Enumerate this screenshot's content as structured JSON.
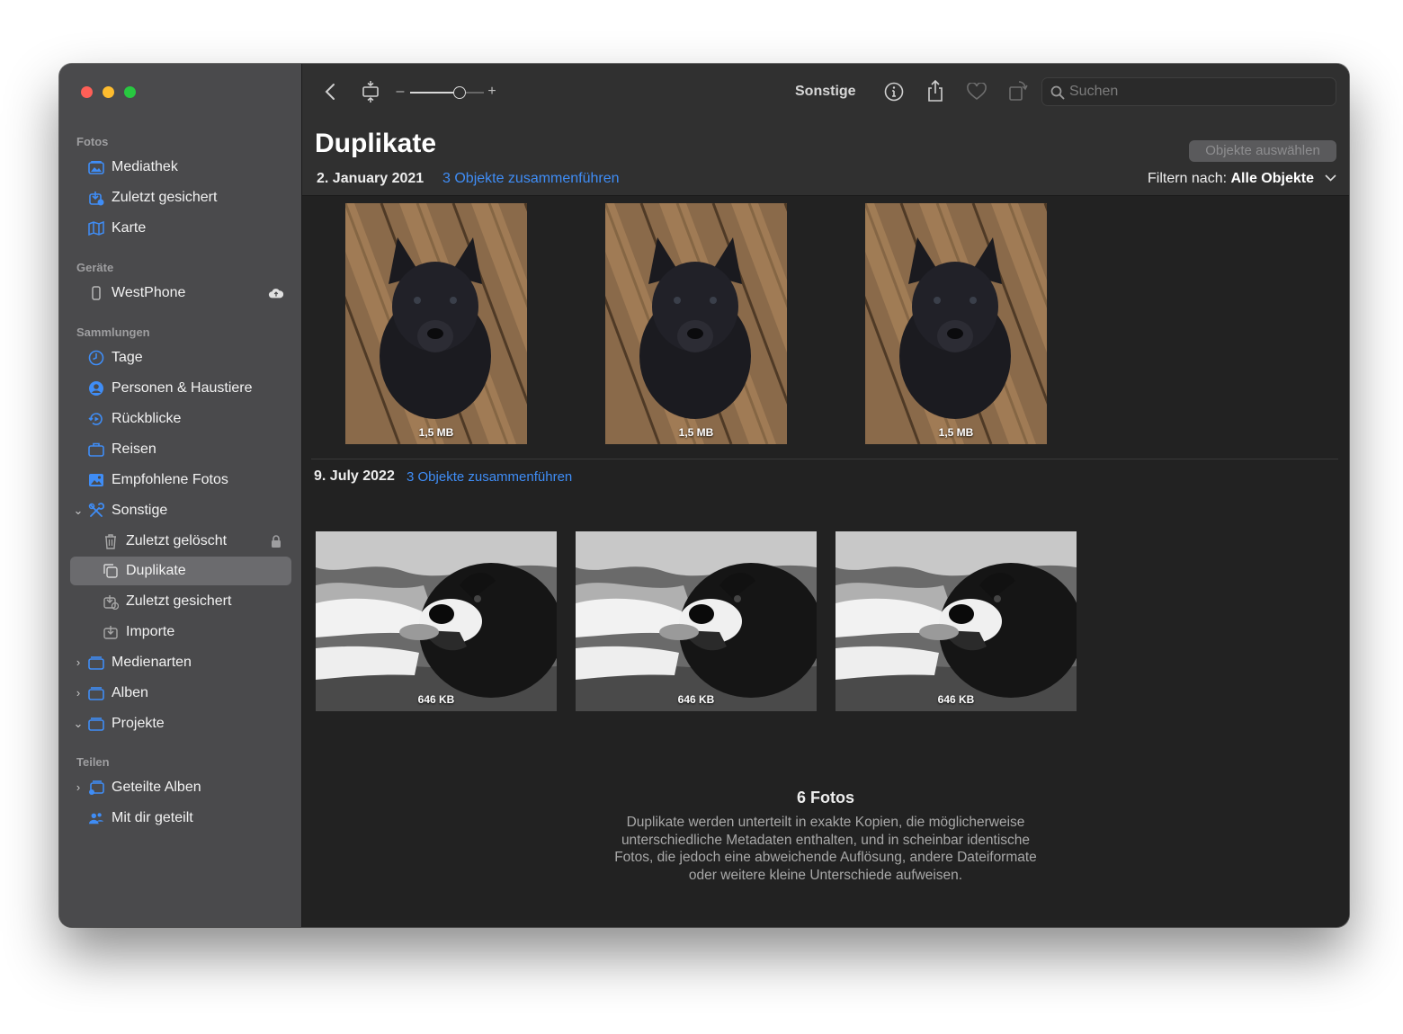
{
  "sidebar": {
    "sections": {
      "fotos": "Fotos",
      "geraete": "Geräte",
      "sammlungen": "Sammlungen",
      "teilen": "Teilen"
    },
    "items": {
      "mediathek": "Mediathek",
      "zuletzt_gesichert": "Zuletzt gesichert",
      "karte": "Karte",
      "westphone": "WestPhone",
      "tage": "Tage",
      "personen": "Personen & Haustiere",
      "rueckblicke": "Rückblicke",
      "reisen": "Reisen",
      "empfohlene": "Empfohlene Fotos",
      "sonstige": "Sonstige",
      "zuletzt_geloescht": "Zuletzt gelöscht",
      "duplikate": "Duplikate",
      "zuletzt_gesichert_sub": "Zuletzt gesichert",
      "importe": "Importe",
      "medienarten": "Medienarten",
      "alben": "Alben",
      "projekte": "Projekte",
      "geteilte_alben": "Geteilte Alben",
      "mit_dir_geteilt": "Mit dir geteilt"
    },
    "selected": "Duplikate"
  },
  "toolbar": {
    "zoom_minus": "–",
    "zoom_plus": "+",
    "zoom_level": 0.7,
    "title": "Sonstige",
    "search_placeholder": "Suchen"
  },
  "main": {
    "page_title": "Duplikate",
    "select_button": "Objekte auswählen",
    "filter_label": "Filtern nach:",
    "filter_value": "Alle Objekte",
    "groups": [
      {
        "date": "2. January 2021",
        "merge_link": "3 Objekte zusammenführen",
        "photos": [
          {
            "size": "1,5 MB"
          },
          {
            "size": "1,5 MB"
          },
          {
            "size": "1,5 MB"
          }
        ]
      },
      {
        "date": "9. July 2022",
        "merge_link": "3 Objekte zusammenführen",
        "photos": [
          {
            "size": "646 KB"
          },
          {
            "size": "646 KB"
          },
          {
            "size": "646 KB"
          }
        ]
      }
    ],
    "footer_count": "6 Fotos",
    "footer_description": "Duplikate werden unterteilt in exakte Kopien, die möglicherweise unterschiedliche Metadaten enthalten, und in scheinbar identische Fotos, die jedoch eine abweichende Auflösung, andere Dateiformate oder weitere kleine Unterschiede aufweisen."
  },
  "colors": {
    "accent": "#3f8df6",
    "sidebar_bg": "#4a4a4c",
    "main_bg": "#222222",
    "toolbar_bg": "#303030",
    "close": "#ff5f57",
    "minimize": "#febc2e",
    "maximize": "#28c840"
  }
}
